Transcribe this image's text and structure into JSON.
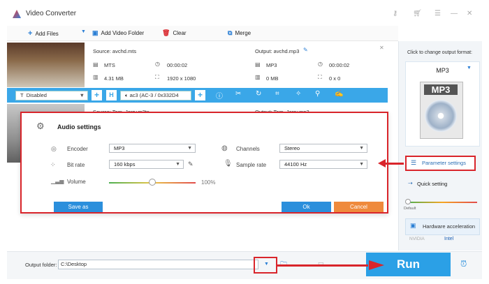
{
  "app": {
    "title": "Video Converter"
  },
  "toolbar": {
    "add_files": "Add Files",
    "add_video_folder": "Add Video Folder",
    "clear": "Clear",
    "merge": "Merge"
  },
  "item1": {
    "source": "Source: avchd.mts",
    "format": "MTS",
    "duration": "00:00:02",
    "size": "4.31 MB",
    "resolution": "1920 x 1080",
    "output": "Output: avchd.mp3",
    "out_format": "MP3",
    "out_duration": "00:00:02",
    "out_size": "0 MB",
    "out_resolution": "0 x 0"
  },
  "item2": {
    "source": "Source: Tom_Jerry.m2ts",
    "output": "Output: Tom_Jerry.mp3"
  },
  "bluebar": {
    "subtitle": "Disabled",
    "audio": "ac3 (AC-3 / 0x332D4"
  },
  "dialog": {
    "title": "Audio settings",
    "encoder_label": "Encoder",
    "encoder_value": "MP3",
    "bitrate_label": "Bit rate",
    "bitrate_value": "160 kbps",
    "volume_label": "Volume",
    "volume_value": "100%",
    "volume_level": 0.5,
    "channels_label": "Channels",
    "channels_value": "Stereo",
    "samplerate_label": "Sample rate",
    "samplerate_value": "44100 Hz",
    "save_as": "Save as",
    "ok": "Ok",
    "cancel": "Cancel"
  },
  "right": {
    "hint": "Click to change output format:",
    "format": "MP3",
    "format_icon_text": "MP3",
    "param_settings": "Parameter settings",
    "quick_setting": "Quick setting",
    "default": "Default",
    "hw_accel": "Hardware acceleration",
    "nvidia": "NVIDIA",
    "intel": "Intel"
  },
  "footer": {
    "output_label": "Output folder:",
    "output_path": "C:\\Desktop",
    "run": "Run"
  },
  "colors": {
    "accent": "#2ba0e6",
    "highlight": "#d9252b"
  }
}
